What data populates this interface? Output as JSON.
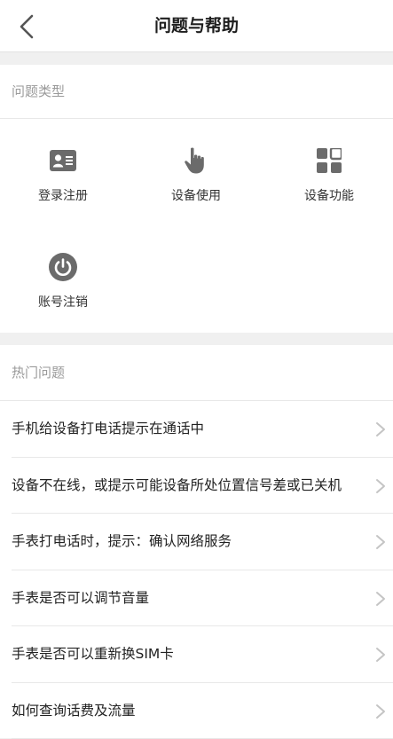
{
  "header": {
    "title": "问题与帮助"
  },
  "categories": {
    "label": "问题类型",
    "items": [
      {
        "label": "登录注册",
        "icon": "id-card-icon"
      },
      {
        "label": "设备使用",
        "icon": "hand-pointer-icon"
      },
      {
        "label": "设备功能",
        "icon": "grid-apps-icon"
      },
      {
        "label": "账号注销",
        "icon": "power-icon"
      }
    ]
  },
  "hot": {
    "label": "热门问题",
    "items": [
      {
        "text": "手机给设备打电话提示在通话中"
      },
      {
        "text": "设备不在线，或提示可能设备所处位置信号差或已关机"
      },
      {
        "text": "手表打电话时，提示：确认网络服务"
      },
      {
        "text": "手表是否可以调节音量"
      },
      {
        "text": "手表是否可以重新换SIM卡"
      },
      {
        "text": "如何查询话费及流量"
      }
    ]
  },
  "colors": {
    "icon": "#6b6b6b",
    "arrow": "#c4c4c4",
    "background": "#f0f0f0",
    "section_label": "#9a9a9a"
  }
}
